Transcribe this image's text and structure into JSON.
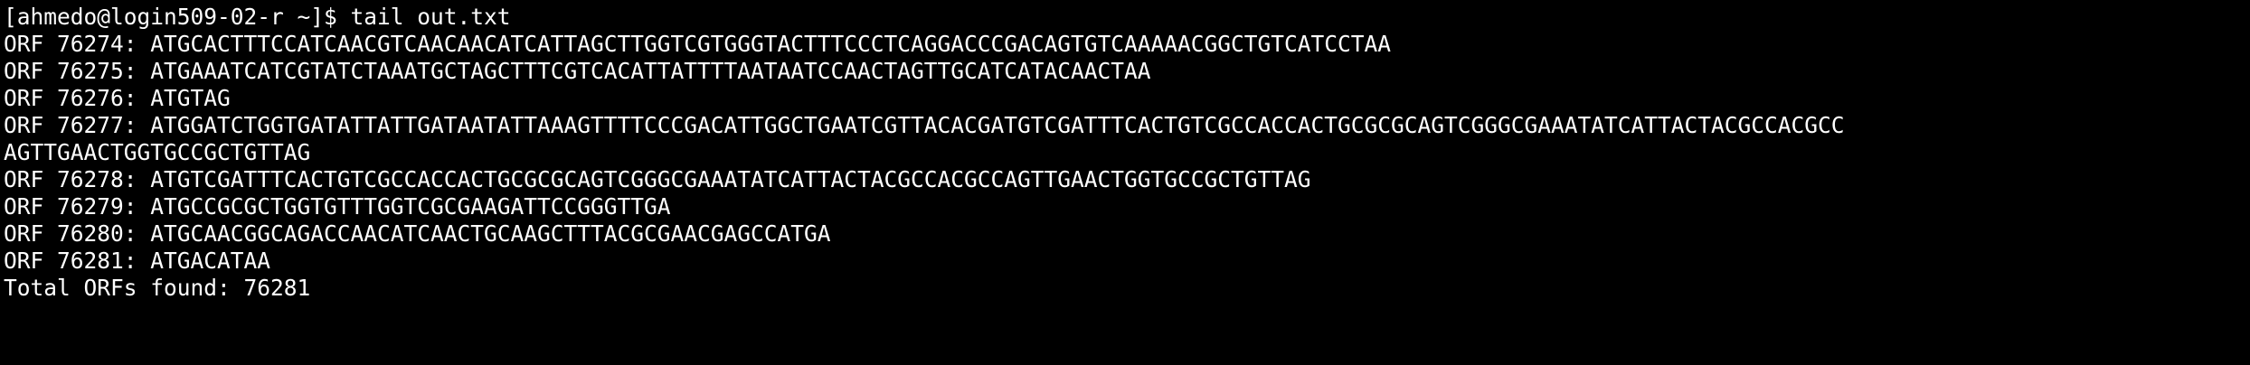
{
  "terminal": {
    "prompt": "[ahmedo@login509-02-r ~]$ ",
    "command": "tail out.txt",
    "lines": [
      "ORF 76274: ATGCACTTTCCATCAACGTCAACAACATCATTAGCTTGGTCGTGGGTACTTTCCCTCAGGACCCGACAGTGTCAAAAACGGCTGTCATCCTAA",
      "ORF 76275: ATGAAATCATCGTATCTAAATGCTAGCTTTCGTCACATTATTTTAATAATCCAACTAGTTGCATCATACAACTAA",
      "ORF 76276: ATGTAG",
      "ORF 76277: ATGGATCTGGTGATATTATTGATAATATTAAAGTTTTCCCGACATTGGCTGAATCGTTACACGATGTCGATTTCACTGTCGCCACCACTGCGCGCAGTCGGGCGAAATATCATTACTACGCCACGCC",
      "AGTTGAACTGGTGCCGCTGTTAG",
      "ORF 76278: ATGTCGATTTCACTGTCGCCACCACTGCGCGCAGTCGGGCGAAATATCATTACTACGCCACGCCAGTTGAACTGGTGCCGCTGTTAG",
      "ORF 76279: ATGCCGCGCTGGTGTTTGGTCGCGAAGATTCCGGGTTGA",
      "ORF 76280: ATGCAACGGCAGACCAACATCAACTGCAAGCTTTACGCGAACGAGCCATGA",
      "ORF 76281: ATGACATAA",
      "Total ORFs found: 76281"
    ]
  }
}
